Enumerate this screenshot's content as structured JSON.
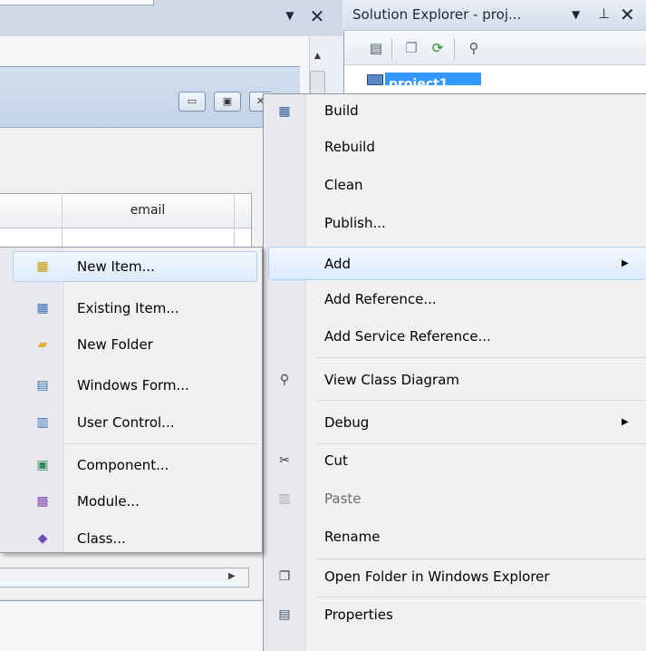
{
  "solution_explorer": {
    "title": "Solution Explorer - proj...",
    "dropdown_icon": "dropdown-arrow-icon",
    "pin_icon": "pin-icon",
    "close_icon": "close-icon",
    "toolbar": [
      "properties-icon",
      "show-all-files-icon",
      "refresh-icon",
      "view-class-diagram-icon"
    ],
    "selected_node": "project1"
  },
  "designer": {
    "grid_header": "email",
    "window_buttons": [
      "minimize-icon",
      "maximize-icon",
      "close-icon"
    ]
  },
  "context_menu": {
    "items": [
      {
        "label": "Build",
        "icon": "build-icon"
      },
      {
        "label": "Rebuild"
      },
      {
        "label": "Clean"
      },
      {
        "label": "Publish..."
      },
      {
        "label": "Add",
        "submenu": true,
        "highlighted": true
      },
      {
        "label": "Add Reference..."
      },
      {
        "label": "Add Service Reference..."
      },
      {
        "label": "View Class Diagram",
        "icon": "class-diagram-icon"
      },
      {
        "label": "Debug",
        "submenu": true
      },
      {
        "label": "Cut",
        "icon": "scissors-icon"
      },
      {
        "label": "Paste",
        "icon": "clipboard-icon",
        "disabled": true
      },
      {
        "label": "Rename"
      },
      {
        "label": "Open Folder in Windows Explorer",
        "icon": "open-folder-icon"
      },
      {
        "label": "Properties",
        "icon": "properties-icon"
      }
    ]
  },
  "add_submenu": {
    "items": [
      {
        "label": "New Item...",
        "icon": "new-item-icon",
        "highlighted": true
      },
      {
        "label": "Existing Item...",
        "icon": "existing-item-icon"
      },
      {
        "label": "New Folder",
        "icon": "new-folder-icon"
      },
      {
        "label": "Windows Form...",
        "icon": "windows-form-icon"
      },
      {
        "label": "User Control...",
        "icon": "user-control-icon"
      },
      {
        "label": "Component...",
        "icon": "component-icon"
      },
      {
        "label": "Module...",
        "icon": "module-icon"
      },
      {
        "label": "Class...",
        "icon": "class-icon"
      }
    ]
  },
  "colors": {
    "menu_background": "#f1f1f1",
    "highlight_border": "#aecff7",
    "selection_blue": "#3399ff"
  }
}
